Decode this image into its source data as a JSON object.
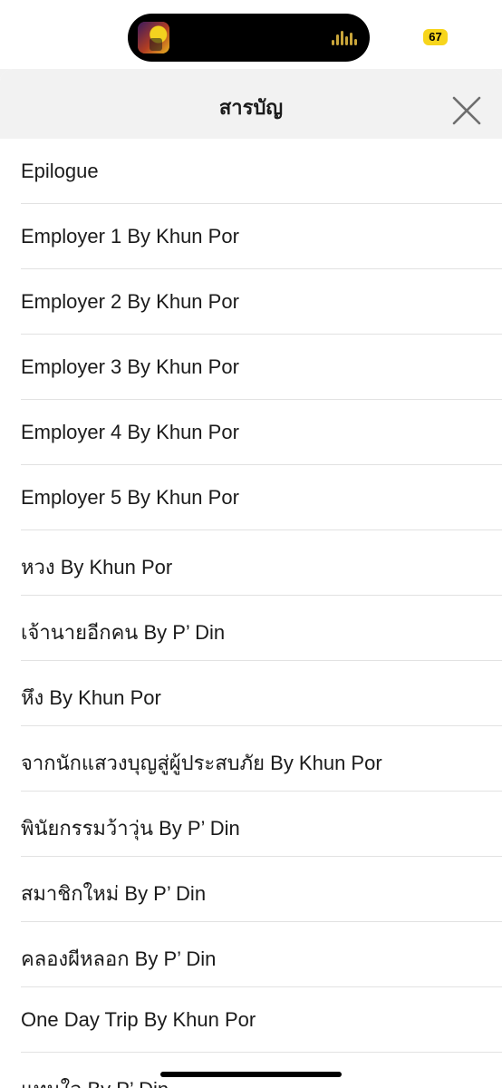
{
  "status_bar": {
    "battery_level": "67",
    "battery_color": "#f7d51c",
    "now_playing_icon": "album-art-icon",
    "audio_icon": "waveform-icon"
  },
  "sheet": {
    "title": "สารบัญ",
    "close_icon": "close-icon"
  },
  "toc": {
    "items": [
      "Epilogue",
      "Employer 1 By Khun Por",
      "Employer 2 By Khun Por",
      "Employer 3 By Khun Por",
      "Employer 4 By Khun Por",
      "Employer 5 By Khun Por",
      "หวง By Khun Por",
      "เจ้านายอีกคน By P’ Din",
      "หึง By Khun Por",
      "จากนักแสวงบุญสู่ผู้ประสบภัย By Khun Por",
      "พินัยกรรมว้าวุ่น By P’ Din",
      "สมาชิกใหม่ By P’ Din",
      "คลองผีหลอก By P’ Din",
      "One Day Trip By Khun Por",
      "แทนใจ By P’ Din"
    ]
  }
}
